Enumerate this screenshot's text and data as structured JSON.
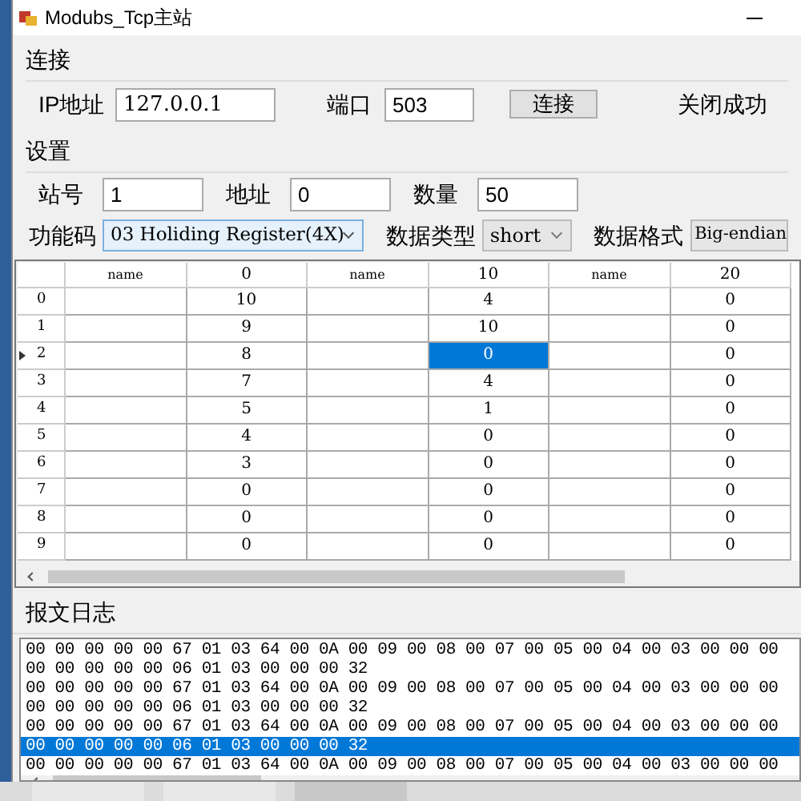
{
  "window": {
    "title": "Modubs_Tcp主站"
  },
  "connection": {
    "legend": "连接",
    "ip_label": "IP地址",
    "ip_value": "127.0.0.1",
    "port_label": "端口",
    "port_value": "503",
    "connect_button": "连接",
    "status": "关闭成功"
  },
  "settings": {
    "legend": "设置",
    "station_label": "站号",
    "station_value": "1",
    "address_label": "地址",
    "address_value": "0",
    "count_label": "数量",
    "count_value": "50",
    "function_label": "功能码",
    "function_value": "03 Holiding Register(4X)",
    "type_label": "数据类型",
    "type_value": "short",
    "format_label": "数据格式",
    "format_value": "Big-endian"
  },
  "table": {
    "columns": [
      "name",
      "0",
      "name",
      "10",
      "name",
      "20"
    ],
    "rows": [
      {
        "header": "0",
        "current": false,
        "cells": [
          {
            "selected": false
          },
          {
            "value": "10",
            "selected": false
          },
          {
            "selected": false
          },
          {
            "value": "4",
            "selected": false
          },
          {
            "selected": false
          },
          {
            "value": "0",
            "selected": false
          }
        ]
      },
      {
        "header": "1",
        "current": false,
        "cells": [
          {
            "selected": false
          },
          {
            "value": "9",
            "selected": false
          },
          {
            "selected": false
          },
          {
            "value": "10",
            "selected": false
          },
          {
            "selected": false
          },
          {
            "value": "0",
            "selected": false
          }
        ]
      },
      {
        "header": "2",
        "current": true,
        "cells": [
          {
            "selected": false
          },
          {
            "value": "8",
            "selected": false
          },
          {
            "selected": false
          },
          {
            "value": "0",
            "selected": true
          },
          {
            "selected": false
          },
          {
            "value": "0",
            "selected": false
          }
        ]
      },
      {
        "header": "3",
        "current": false,
        "cells": [
          {
            "selected": false
          },
          {
            "value": "7",
            "selected": false
          },
          {
            "selected": false
          },
          {
            "value": "4",
            "selected": false
          },
          {
            "selected": false
          },
          {
            "value": "0",
            "selected": false
          }
        ]
      },
      {
        "header": "4",
        "current": false,
        "cells": [
          {
            "selected": false
          },
          {
            "value": "5",
            "selected": false
          },
          {
            "selected": false
          },
          {
            "value": "1",
            "selected": false
          },
          {
            "selected": false
          },
          {
            "value": "0",
            "selected": false
          }
        ]
      },
      {
        "header": "5",
        "current": false,
        "cells": [
          {
            "selected": false
          },
          {
            "value": "4",
            "selected": false
          },
          {
            "selected": false
          },
          {
            "value": "0",
            "selected": false
          },
          {
            "selected": false
          },
          {
            "value": "0",
            "selected": false
          }
        ]
      },
      {
        "header": "6",
        "current": false,
        "cells": [
          {
            "selected": false
          },
          {
            "value": "3",
            "selected": false
          },
          {
            "selected": false
          },
          {
            "value": "0",
            "selected": false
          },
          {
            "selected": false
          },
          {
            "value": "0",
            "selected": false
          }
        ]
      },
      {
        "header": "7",
        "current": false,
        "cells": [
          {
            "selected": false
          },
          {
            "value": "0",
            "selected": false
          },
          {
            "selected": false
          },
          {
            "value": "0",
            "selected": false
          },
          {
            "selected": false
          },
          {
            "value": "0",
            "selected": false
          }
        ]
      },
      {
        "header": "8",
        "current": false,
        "cells": [
          {
            "selected": false
          },
          {
            "value": "0",
            "selected": false
          },
          {
            "selected": false
          },
          {
            "value": "0",
            "selected": false
          },
          {
            "selected": false
          },
          {
            "value": "0",
            "selected": false
          }
        ]
      },
      {
        "header": "9",
        "current": false,
        "cells": [
          {
            "selected": false
          },
          {
            "value": "0",
            "selected": false
          },
          {
            "selected": false
          },
          {
            "value": "0",
            "selected": false
          },
          {
            "selected": false
          },
          {
            "value": "0",
            "selected": false
          }
        ]
      }
    ]
  },
  "log": {
    "legend": "报文日志",
    "lines": [
      {
        "text": "00 00 00 00 00 67 01 03 64 00 0A 00 09 00 08 00 07 00 05 00 04 00 03 00 00 00",
        "selected": false
      },
      {
        "text": "00 00 00 00 00 06 01 03 00 00 00 32",
        "selected": false
      },
      {
        "text": "00 00 00 00 00 67 01 03 64 00 0A 00 09 00 08 00 07 00 05 00 04 00 03 00 00 00",
        "selected": false
      },
      {
        "text": "00 00 00 00 00 06 01 03 00 00 00 32",
        "selected": false
      },
      {
        "text": "00 00 00 00 00 67 01 03 64 00 0A 00 09 00 08 00 07 00 05 00 04 00 03 00 00 00",
        "selected": false
      },
      {
        "text": "00 00 00 00 00 06 01 03 00 00 00 32",
        "selected": true
      },
      {
        "text": "00 00 00 00 00 67 01 03 64 00 0A 00 09 00 08 00 07 00 05 00 04 00 03 00 00 00",
        "selected": false
      }
    ]
  }
}
